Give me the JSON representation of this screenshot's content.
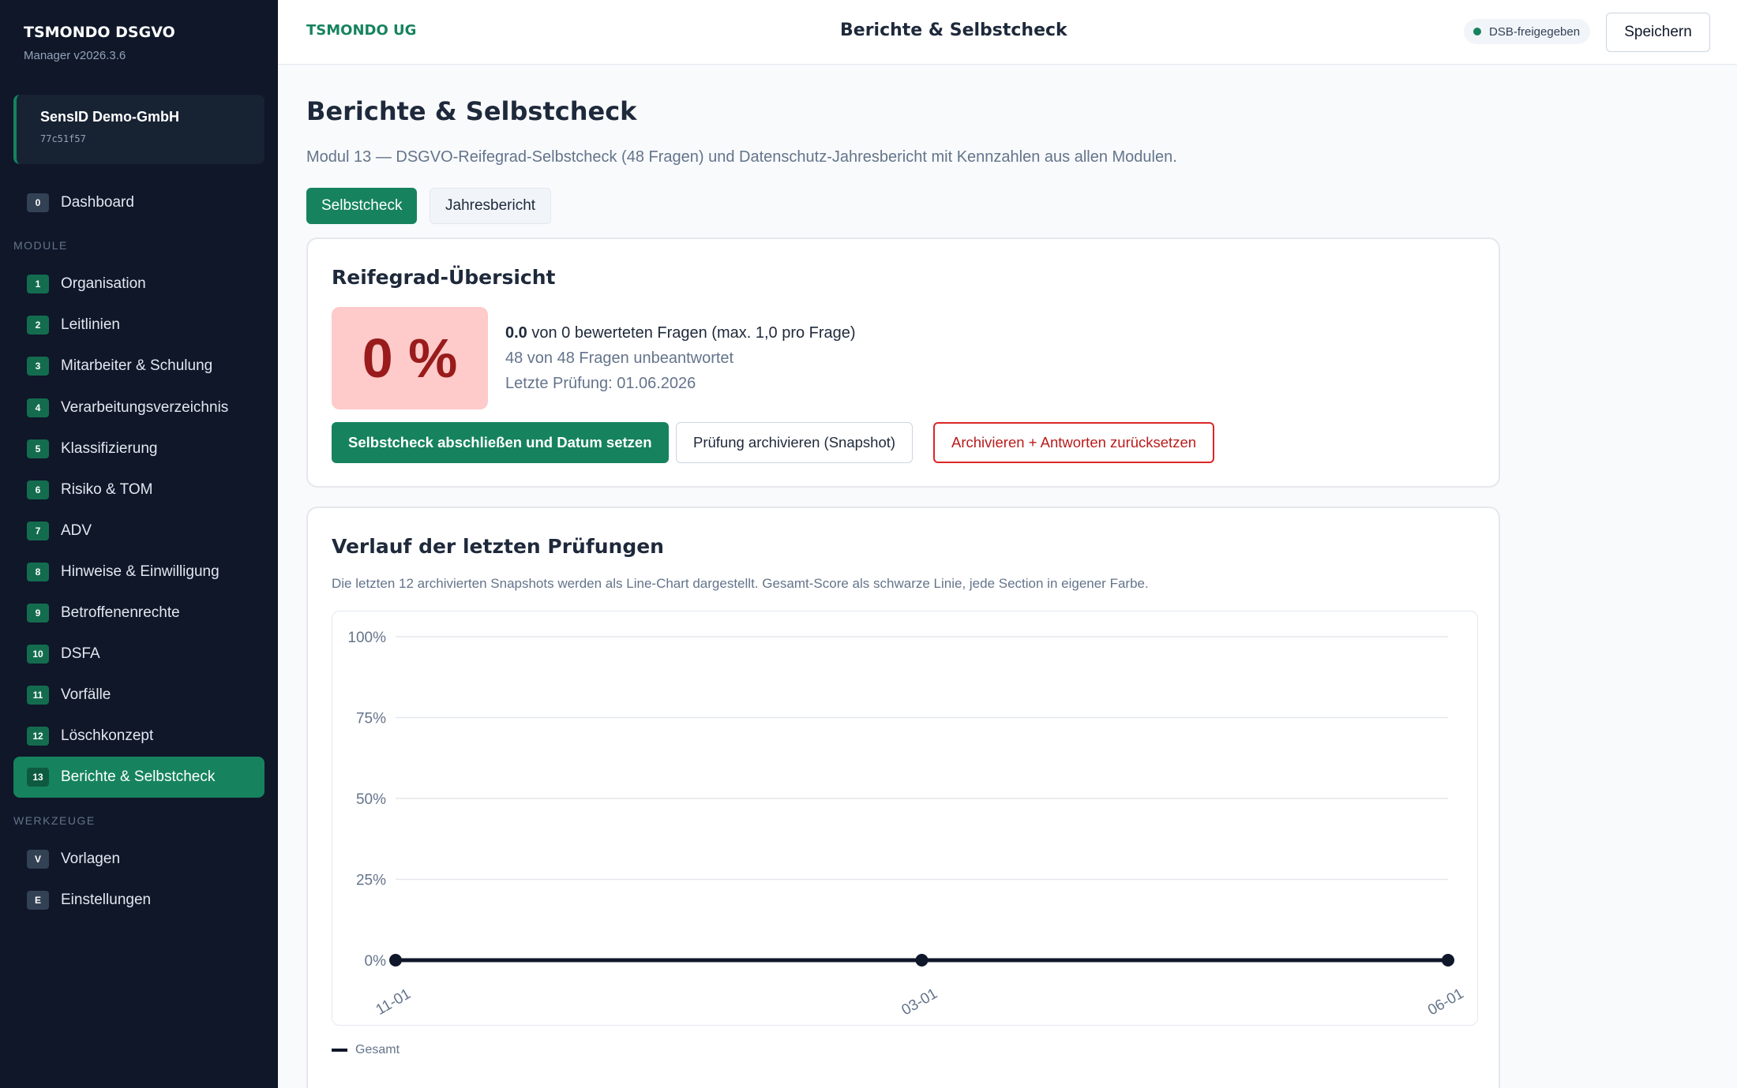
{
  "sidebar": {
    "title": "TSMONDO DSGVO",
    "version": "Manager v2026.3.6",
    "tenant": {
      "name": "SensID Demo-GmbH",
      "id": "77c51f57"
    },
    "dashboard": {
      "num": "0",
      "label": "Dashboard"
    },
    "section_modules": "MODULE",
    "modules": [
      {
        "num": "1",
        "label": "Organisation"
      },
      {
        "num": "2",
        "label": "Leitlinien"
      },
      {
        "num": "3",
        "label": "Mitarbeiter & Schulung"
      },
      {
        "num": "4",
        "label": "Verarbeitungsverzeichnis"
      },
      {
        "num": "5",
        "label": "Klassifizierung"
      },
      {
        "num": "6",
        "label": "Risiko & TOM"
      },
      {
        "num": "7",
        "label": "ADV"
      },
      {
        "num": "8",
        "label": "Hinweise & Einwilligung"
      },
      {
        "num": "9",
        "label": "Betroffenenrechte"
      },
      {
        "num": "10",
        "label": "DSFA"
      },
      {
        "num": "11",
        "label": "Vorfälle"
      },
      {
        "num": "12",
        "label": "Löschkonzept"
      },
      {
        "num": "13",
        "label": "Berichte & Selbstcheck"
      }
    ],
    "active_module": "13",
    "section_tools": "WERKZEUGE",
    "tools": [
      {
        "num": "V",
        "label": "Vorlagen"
      },
      {
        "num": "E",
        "label": "Einstellungen"
      }
    ]
  },
  "topbar": {
    "company": "TSMONDO UG",
    "title": "Berichte & Selbstcheck",
    "status": "DSB-freigegeben",
    "save_label": "Speichern"
  },
  "main": {
    "title": "Berichte & Selbstcheck",
    "subtitle": "Modul 13 — DSGVO-Reifegrad-Selbstcheck (48 Fragen) und Datenschutz-Jahresbericht mit Kennzahlen aus allen Modulen.",
    "tabs": [
      {
        "label": "Selbstcheck",
        "active": true
      },
      {
        "label": "Jahresbericht",
        "active": false
      }
    ]
  },
  "maturity": {
    "title": "Reifegrad-Übersicht",
    "score": "0 %",
    "points": "0.0",
    "points_text": "von 0 bewerteten Fragen (max. 1,0 pro Frage)",
    "unanswered": "48 von 48 Fragen unbeantwortet",
    "last_check": "Letzte Prüfung: 01.06.2026",
    "buttons": {
      "complete": "Selbstcheck abschließen und Datum setzen",
      "archive": "Prüfung archivieren (Snapshot)",
      "archive_reset": "Archivieren + Antworten zurücksetzen"
    }
  },
  "history": {
    "title": "Verlauf der letzten Prüfungen",
    "description": "Die letzten 12 archivierten Snapshots werden als Line-Chart dargestellt. Gesamt-Score als schwarze Linie, jede Section in eigener Farbe.",
    "legend": "Gesamt"
  },
  "colors": {
    "sidebar_bg": "#0f1729",
    "accent": "#16835e",
    "danger": "#dc2626",
    "score_bg": "#fecaca",
    "score_text": "#991b1b",
    "line": "#0f172a"
  },
  "icons": [
    "status-dot-icon",
    "legend-line-icon"
  ],
  "chart_data": {
    "type": "line",
    "x": [
      "11-01",
      "03-01",
      "06-01"
    ],
    "series": [
      {
        "name": "Gesamt",
        "values": [
          0,
          0,
          0
        ],
        "color": "#0f172a"
      }
    ],
    "y_ticks": [
      "100%",
      "75%",
      "50%",
      "25%",
      "0%"
    ],
    "ylim": [
      0,
      100
    ],
    "grid": true,
    "legend": "bottom-left"
  }
}
